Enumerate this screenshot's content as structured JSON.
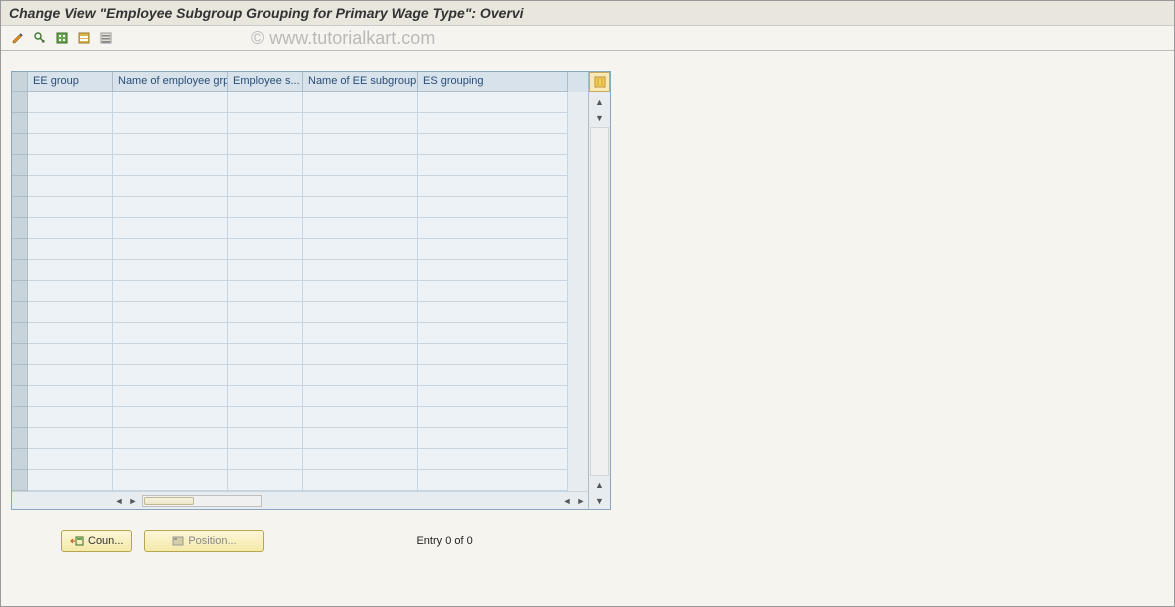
{
  "title": "Change View \"Employee Subgroup Grouping for Primary Wage Type\": Overvi",
  "watermark": "© www.tutorialkart.com",
  "toolbar": {
    "icons": [
      "display-change-icon",
      "another-icon",
      "select-all-icon",
      "select-block-icon",
      "deselect-all-icon"
    ]
  },
  "table": {
    "columns": [
      {
        "key": "ee_group",
        "label": "EE group"
      },
      {
        "key": "name_grp",
        "label": "Name of employee grp"
      },
      {
        "key": "emp_s",
        "label": "Employee s..."
      },
      {
        "key": "name_sub",
        "label": "Name of EE subgroup"
      },
      {
        "key": "es_grp",
        "label": "ES grouping"
      }
    ],
    "row_count": 19,
    "rows": []
  },
  "footer": {
    "coun_label": "Coun...",
    "position_label": "Position...",
    "entry_text": "Entry 0 of 0"
  }
}
